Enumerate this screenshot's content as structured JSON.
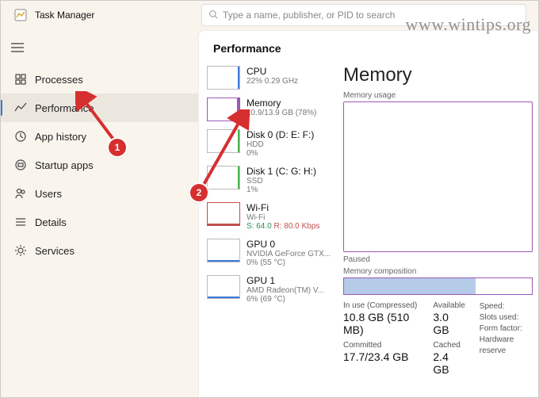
{
  "app": {
    "title": "Task Manager"
  },
  "search": {
    "placeholder": "Type a name, publisher, or PID to search"
  },
  "sidebar": {
    "items": [
      {
        "label": "Processes"
      },
      {
        "label": "Performance"
      },
      {
        "label": "App history"
      },
      {
        "label": "Startup apps"
      },
      {
        "label": "Users"
      },
      {
        "label": "Details"
      },
      {
        "label": "Services"
      }
    ]
  },
  "perf": {
    "heading": "Performance",
    "list": {
      "cpu": {
        "title": "CPU",
        "sub": "22%  0.29 GHz"
      },
      "memory": {
        "title": "Memory",
        "sub": "10.9/13.9 GB (78%)"
      },
      "disk0": {
        "title": "Disk 0 (D: E: F:)",
        "sub": "HDD",
        "sub2": "0%"
      },
      "disk1": {
        "title": "Disk 1 (C: G: H:)",
        "sub": "SSD",
        "sub2": "1%"
      },
      "wifi": {
        "title": "Wi-Fi",
        "sub": "Wi-Fi",
        "sub2_send": "S: 64.0",
        "sub2_recv": "R: 80.0 Kbps"
      },
      "gpu0": {
        "title": "GPU 0",
        "sub": "NVIDIA GeForce GTX...",
        "sub2": "0%  (55 °C)"
      },
      "gpu1": {
        "title": "GPU 1",
        "sub": "AMD Radeon(TM) V...",
        "sub2": "6%  (69 °C)"
      }
    },
    "detail": {
      "title": "Memory",
      "usage_label": "Memory usage",
      "paused": "Paused",
      "comp_label": "Memory composition",
      "stats": {
        "in_use_label": "In use (Compressed)",
        "in_use": "10.8 GB (510 MB)",
        "available_label": "Available",
        "available": "3.0 GB",
        "committed_label": "Committed",
        "committed": "17.7/23.4 GB",
        "cached_label": "Cached",
        "cached": "2.4 GB",
        "speed_label": "Speed:",
        "slots_label": "Slots used:",
        "form_label": "Form factor:",
        "hw_label": "Hardware reserve"
      }
    }
  },
  "callouts": {
    "one": "1",
    "two": "2"
  },
  "watermark": "www.wintips.org"
}
